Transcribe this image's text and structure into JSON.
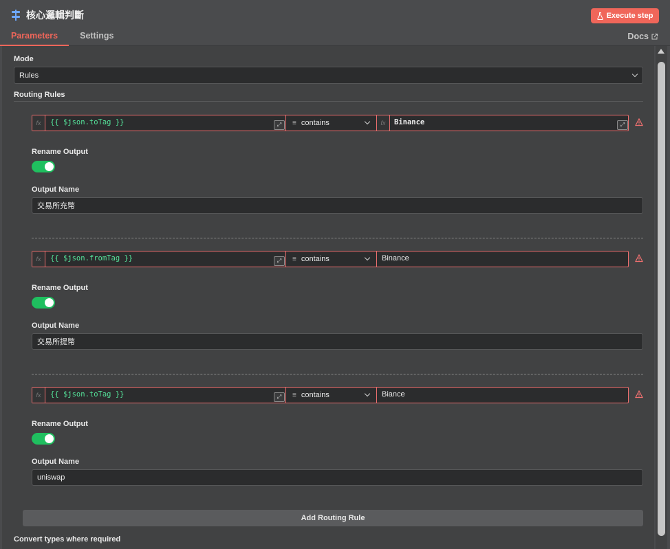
{
  "header": {
    "title": "核心邏輯判斷",
    "execute_label": "Execute step",
    "docs_label": "Docs",
    "tabs": [
      {
        "label": "Parameters",
        "active": true
      },
      {
        "label": "Settings",
        "active": false
      }
    ]
  },
  "mode": {
    "label": "Mode",
    "value": "Rules"
  },
  "routing": {
    "label": "Routing Rules",
    "rules": [
      {
        "left_expr": "{{ $json.toTag }}",
        "operator": "contains",
        "right_value": "Binance",
        "rename_label": "Rename Output",
        "rename_on": true,
        "output_name_label": "Output Name",
        "output_name": "交易所充幣"
      },
      {
        "left_expr": "{{ $json.fromTag }}",
        "operator": "contains",
        "right_value": "Binance",
        "rename_label": "Rename Output",
        "rename_on": true,
        "output_name_label": "Output Name",
        "output_name": "交易所提幣"
      },
      {
        "left_expr": "{{ $json.toTag }}",
        "operator": "contains",
        "right_value": "Biance",
        "rename_label": "Rename Output",
        "rename_on": true,
        "output_name_label": "Output Name",
        "output_name": "uniswap"
      }
    ],
    "add_label": "Add Routing Rule"
  },
  "convert_label": "Convert types where required",
  "colors": {
    "accent": "#f0665a",
    "toggle_on": "#1fbf5f",
    "expression": "#55e39a",
    "error_border": "#f07070"
  }
}
